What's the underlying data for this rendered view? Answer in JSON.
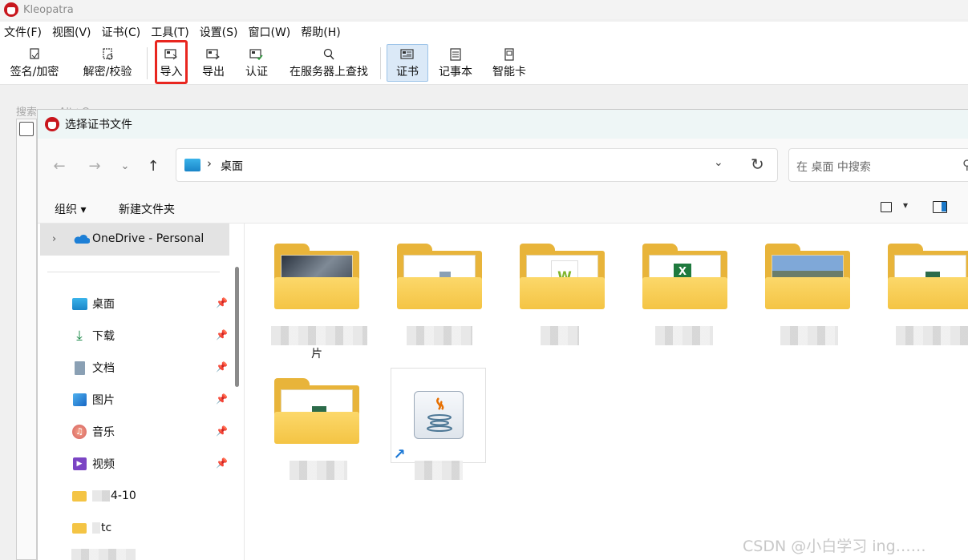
{
  "app": {
    "title": "Kleopatra",
    "menu": [
      "文件(F)",
      "视图(V)",
      "证书(C)",
      "工具(T)",
      "设置(S)",
      "窗口(W)",
      "帮助(H)"
    ],
    "toolbar": {
      "sign_encrypt": "签名/加密",
      "decrypt_verify": "解密/校验",
      "import": "导入",
      "export": "导出",
      "certify": "认证",
      "lookup_server": "在服务器上查找",
      "certificates": "证书",
      "notepad": "记事本",
      "smartcards": "智能卡"
    },
    "bg_search": "搜索...  <Alt+Q>"
  },
  "dialog": {
    "title": "选择证书文件",
    "address": {
      "location": "桌面"
    },
    "search": {
      "placeholder": "在 桌面 中搜索"
    },
    "commands": {
      "organize": "组织 ▾",
      "new_folder": "新建文件夹"
    },
    "nav": {
      "onedrive": "OneDrive - Personal",
      "items": [
        {
          "label": "桌面",
          "icon": "desktop-icon"
        },
        {
          "label": "下载",
          "icon": "download-icon"
        },
        {
          "label": "文档",
          "icon": "document-icon"
        },
        {
          "label": "图片",
          "icon": "pictures-icon"
        },
        {
          "label": "音乐",
          "icon": "music-icon"
        },
        {
          "label": "视频",
          "icon": "video-icon"
        },
        {
          "label": "4-10",
          "icon": "folder-icon"
        },
        {
          "label": "tc",
          "icon": "folder-icon"
        }
      ]
    },
    "files": {
      "folder1_suffix": "片"
    }
  },
  "watermark": "CSDN @小白学习 ing……"
}
